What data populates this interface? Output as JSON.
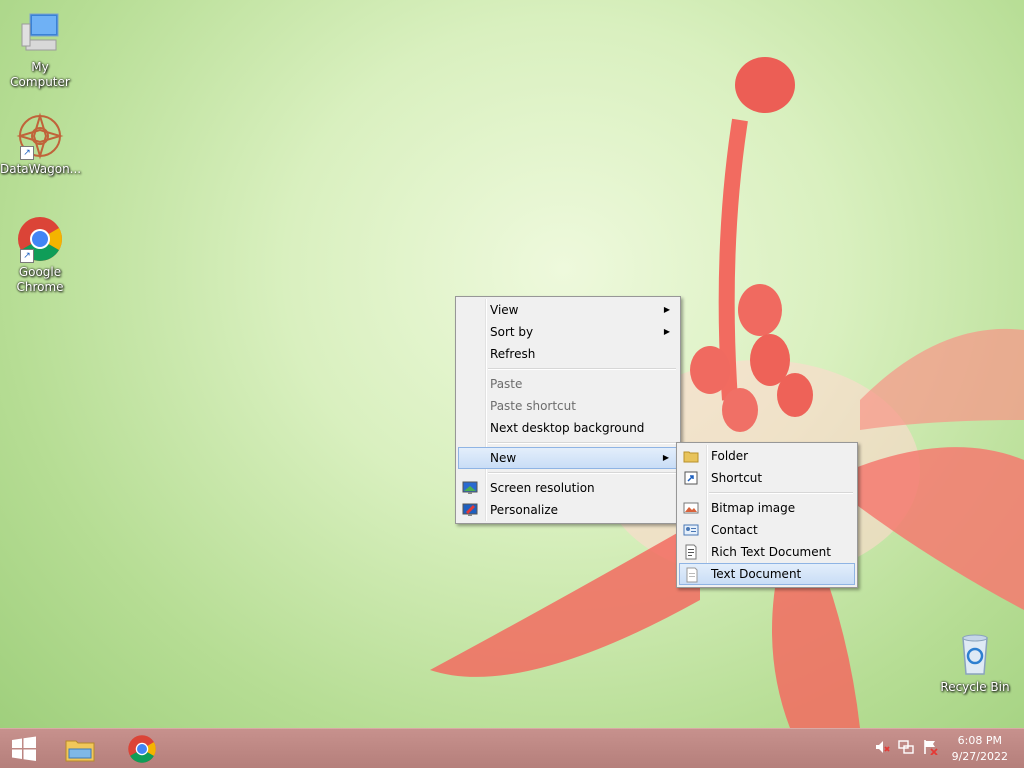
{
  "desktop_icons": [
    {
      "label": "My Computer",
      "icon": "my-computer-icon"
    },
    {
      "label": "DataWagon...",
      "icon": "datawagon-icon"
    },
    {
      "label": "Google Chrome",
      "icon": "chrome-icon"
    },
    {
      "label": "Recycle Bin",
      "icon": "recycle-bin-icon"
    }
  ],
  "context_menu": {
    "items": [
      "View",
      "Sort by",
      "Refresh",
      "Paste",
      "Paste shortcut",
      "Next desktop background",
      "New",
      "Screen resolution",
      "Personalize"
    ]
  },
  "new_submenu": {
    "items": [
      "Folder",
      "Shortcut",
      "Bitmap image",
      "Contact",
      "Rich Text Document",
      "Text Document"
    ],
    "highlighted": "Text Document"
  },
  "taskbar": {
    "time": "6:08 PM",
    "date": "9/27/2022",
    "pinned": [
      "windows-start-icon",
      "file-explorer-icon",
      "chrome-icon"
    ],
    "tray": [
      "volume-muted-icon",
      "network-icon",
      "action-center-icon"
    ]
  },
  "colors": {
    "highlight": "#c9ddf6",
    "taskbar": "#b57f7b",
    "desktop": "#b6dd94"
  }
}
